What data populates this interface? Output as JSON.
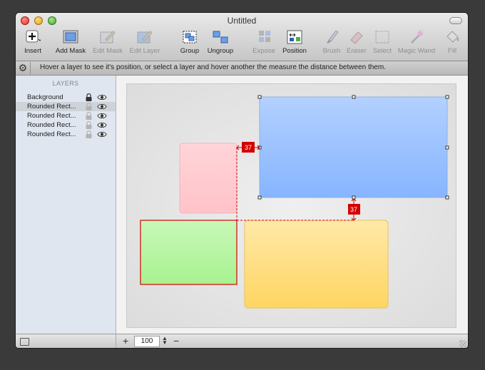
{
  "window": {
    "title": "Untitled"
  },
  "toolbar": {
    "insert": "Insert",
    "add_mask": "Add Mask",
    "edit_mask": "Edit Mask",
    "edit_layer": "Edit Layer",
    "group": "Group",
    "ungroup": "Ungroup",
    "expose": "Expose",
    "position": "Position",
    "brush": "Brush",
    "eraser": "Eraser",
    "select": "Select",
    "magic_wand": "Magic Wand",
    "fill": "Fill"
  },
  "infobar": {
    "hint": "Hover a layer to see it's position, or select a layer and hover another the measure the distance between them."
  },
  "sidebar": {
    "header": "LAYERS",
    "layers": [
      {
        "name": "Background",
        "locked": true
      },
      {
        "name": "Rounded Rect...",
        "locked": false
      },
      {
        "name": "Rounded Rect...",
        "locked": false
      },
      {
        "name": "Rounded Rect...",
        "locked": false
      },
      {
        "name": "Rounded Rect...",
        "locked": false
      }
    ]
  },
  "canvas": {
    "measure_horizontal": "37",
    "measure_vertical": "37",
    "colors": {
      "blue": "#8fbcff",
      "pink": "#ffcdd2",
      "green": "#b7f5a6",
      "yellow": "#ffd97a",
      "measure": "#d40000"
    }
  },
  "status": {
    "zoom": "100"
  }
}
